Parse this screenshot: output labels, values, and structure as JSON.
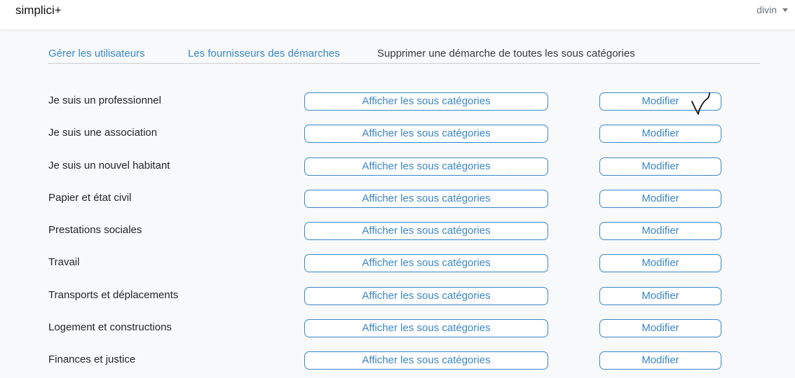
{
  "header": {
    "brand": "simplici+",
    "user": "divin"
  },
  "tabs": [
    {
      "label": "Gérer les utilisateurs"
    },
    {
      "label": "Les fournisseurs des démarches"
    },
    {
      "label": "Supprimer une démarche de toutes les sous catégories"
    }
  ],
  "colors": {
    "link": "#3a86c8",
    "text": "#212529",
    "background": "#f8f9fa"
  },
  "rows": [
    {
      "label": "Je suis un professionnel",
      "sub_button": "Afficher les sous catégories",
      "edit_button": "Modifier"
    },
    {
      "label": "Je suis une association",
      "sub_button": "Afficher les sous catégories",
      "edit_button": "Modifier"
    },
    {
      "label": "Je suis un nouvel habitant",
      "sub_button": "Afficher les sous catégories",
      "edit_button": "Modifier"
    },
    {
      "label": "Papier et état civil",
      "sub_button": "Afficher les sous catégories",
      "edit_button": "Modifier"
    },
    {
      "label": "Prestations sociales",
      "sub_button": "Afficher les sous catégories",
      "edit_button": "Modifier"
    },
    {
      "label": "Travail",
      "sub_button": "Afficher les sous catégories",
      "edit_button": "Modifier"
    },
    {
      "label": "Transports et déplacements",
      "sub_button": "Afficher les sous catégories",
      "edit_button": "Modifier"
    },
    {
      "label": "Logement et constructions",
      "sub_button": "Afficher les sous catégories",
      "edit_button": "Modifier"
    },
    {
      "label": "Finances et justice",
      "sub_button": "Afficher les sous catégories",
      "edit_button": "Modifier"
    }
  ]
}
